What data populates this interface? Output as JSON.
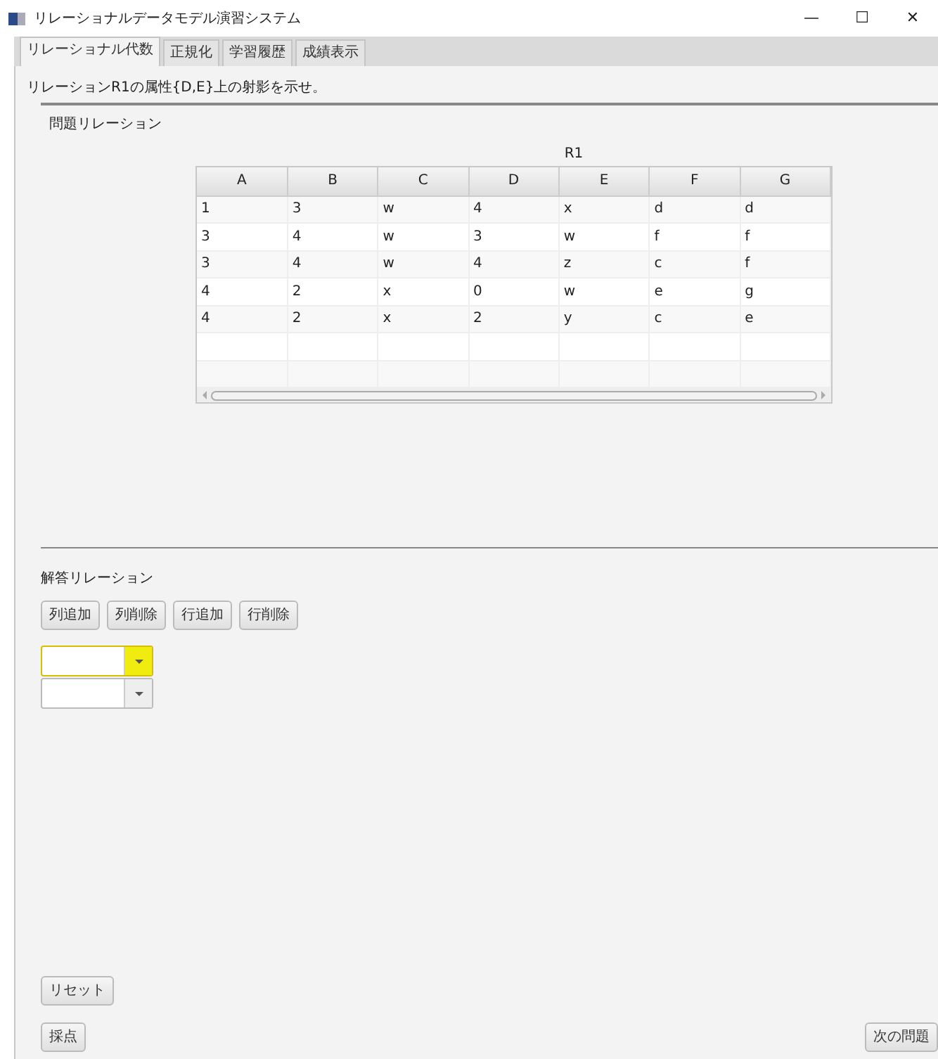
{
  "window": {
    "title": "リレーショナルデータモデル演習システム",
    "controls": [
      "—",
      "☐",
      "✕"
    ]
  },
  "tabs": [
    {
      "label": "リレーショナル代数",
      "selected": true
    },
    {
      "label": "正規化",
      "selected": false
    },
    {
      "label": "学習履歴",
      "selected": false
    },
    {
      "label": "成績表示",
      "selected": false
    }
  ],
  "question": "リレーションR1の属性{D,E}上の射影を示せ。",
  "problem": {
    "heading": "問題リレーション",
    "table_title": "R1",
    "table": {
      "columns": [
        "A",
        "B",
        "C",
        "D",
        "E",
        "F",
        "G"
      ],
      "rows": [
        [
          "1",
          "3",
          "w",
          "4",
          "x",
          "d",
          "d"
        ],
        [
          "3",
          "4",
          "w",
          "3",
          "w",
          "f",
          "f"
        ],
        [
          "3",
          "4",
          "w",
          "4",
          "z",
          "c",
          "f"
        ],
        [
          "4",
          "2",
          "x",
          "0",
          "w",
          "e",
          "g"
        ],
        [
          "4",
          "2",
          "x",
          "2",
          "y",
          "c",
          "e"
        ]
      ]
    }
  },
  "answer": {
    "heading": "解答リレーション",
    "buttons": [
      "列追加",
      "列削除",
      "行追加",
      "行削除"
    ],
    "combos": [
      {
        "focused": true
      },
      {
        "focused": false
      }
    ]
  },
  "reset_button": "リセット",
  "grade_button": "採点",
  "next_button": "次の問題"
}
